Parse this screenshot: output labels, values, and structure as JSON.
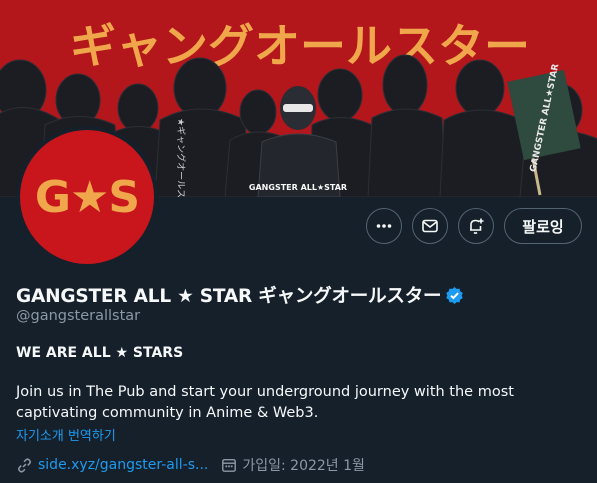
{
  "banner": {
    "headline": "ギャングオールスター",
    "jacket_text": "GANGSTER ALL★STAR",
    "flag_text": "GANGSTER ALL★STAR",
    "back_text": "★ギャングオールスター"
  },
  "avatar": {
    "text": "G★S"
  },
  "actions": {
    "more_label": "more",
    "message_label": "message",
    "notify_label": "notify",
    "follow_label": "팔로잉"
  },
  "profile": {
    "display_name": "GANGSTER ALL ★ STAR ギャングオールスター",
    "handle": "@gangsterallstar",
    "tagline": "WE ARE ALL ★ STARS",
    "bio": "Join us in The Pub and start your underground journey with the most captivating community in Anime & Web3.",
    "translate_label": "자기소개 번역하기",
    "website": "side.xyz/gangster-all-s...",
    "joined": "가입일: 2022년 1월"
  },
  "colors": {
    "background": "#15202b",
    "accent": "#1d9bf0",
    "banner_red": "#b3161b",
    "banner_text": "#f0a64a"
  }
}
